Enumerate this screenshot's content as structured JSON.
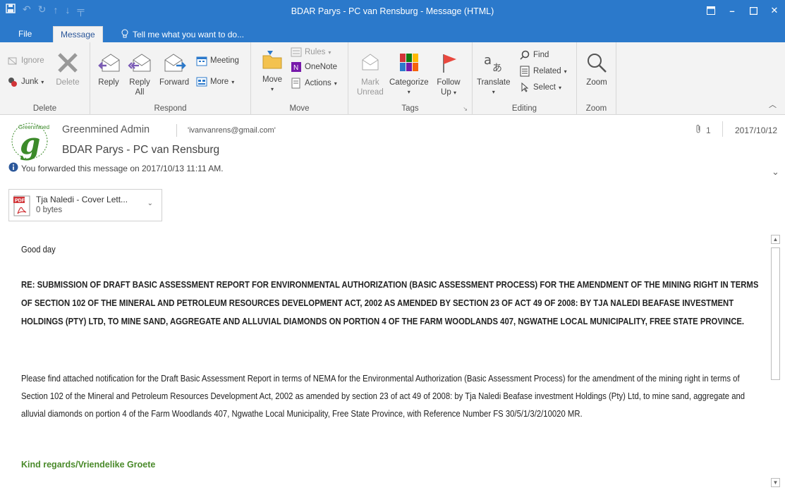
{
  "window": {
    "title": "BDAR Parys - PC van Rensburg - Message (HTML)"
  },
  "tabs": {
    "file": "File",
    "message": "Message",
    "tell_me": "Tell me what you want to do..."
  },
  "ribbon": {
    "delete_group": {
      "label": "Delete",
      "ignore": "Ignore",
      "junk": "Junk",
      "delete": "Delete"
    },
    "respond_group": {
      "label": "Respond",
      "reply": "Reply",
      "reply_all_line1": "Reply",
      "reply_all_line2": "All",
      "forward": "Forward",
      "meeting": "Meeting",
      "more": "More"
    },
    "move_group": {
      "label": "Move",
      "move": "Move",
      "rules": "Rules",
      "onenote": "OneNote",
      "actions": "Actions"
    },
    "tags_group": {
      "label": "Tags",
      "mark_unread_line1": "Mark",
      "mark_unread_line2": "Unread",
      "categorize": "Categorize",
      "follow_up_line1": "Follow",
      "follow_up_line2": "Up"
    },
    "editing_group": {
      "label": "Editing",
      "translate": "Translate",
      "find": "Find",
      "related": "Related",
      "select": "Select"
    },
    "zoom_group": {
      "label": "Zoom",
      "zoom": "Zoom"
    }
  },
  "message": {
    "sender": "Greenmined Admin",
    "to": "'ivanvanrens@gmail.com'",
    "subject": "BDAR Parys - PC van Rensburg",
    "info": "You forwarded this message on 2017/10/13 11:11 AM.",
    "attachment_count": "1",
    "date": "2017/10/12",
    "logo_text": "Greenmined"
  },
  "attachment": {
    "name": "Tja Naledi - Cover Lett...",
    "size": "0 bytes",
    "type_label": "PDF"
  },
  "body": {
    "greeting": "Good day",
    "re": "RE: SUBMISSION OF DRAFT BASIC ASSESSMENT REPORT FOR ENVIRONMENTAL AUTHORIZATION (BASIC ASSESSMENT PROCESS) FOR THE AMENDMENT OF THE MINING RIGHT IN TERMS OF SECTION 102 OF THE MINERAL AND PETROLEUM RESOURCES DEVELOPMENT ACT, 2002 AS AMENDED BY SECTION 23 OF ACT 49 OF 2008: BY TJA NALEDI BEAFASE INVESTMENT HOLDINGS (PTY) LTD, TO MINE SAND, AGGREGATE AND ALLUVIAL DIAMONDS ON PORTION 4 OF THE FARM WOODLANDS 407, NGWATHE LOCAL MUNICIPALITY, FREE STATE PROVINCE.",
    "paragraph": "Please find attached notification for the Draft Basic Assessment Report in terms of NEMA for the Environmental Authorization (Basic Assessment Process) for the amendment of the mining right in terms of Section 102 of the Mineral and Petroleum Resources Development Act, 2002 as amended by section 23 of act 49 of 2008: by Tja Naledi Beafase investment Holdings (Pty) Ltd, to mine sand, aggregate and alluvial diamonds on portion 4 of the Farm Woodlands 407, Ngwathe Local Municipality, Free State Province, with Reference Number FS 30/5/1/3/2/10020 MR.",
    "regards": "Kind regards/Vriendelike Groete"
  },
  "colors": {
    "titlebar": "#2b79cb",
    "ribbon": "#f3f3f3",
    "regards_green": "#4a8a2a",
    "accent_blue": "#2b579a"
  }
}
